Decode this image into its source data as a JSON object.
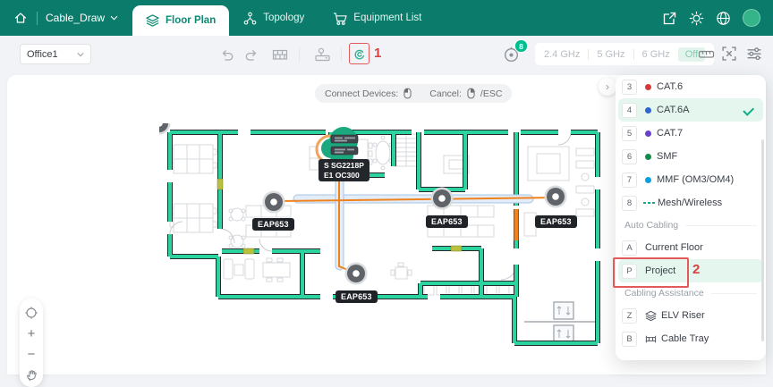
{
  "header": {
    "project_name": "Cable_Draw",
    "tabs": [
      {
        "label": "Floor Plan",
        "active": true
      },
      {
        "label": "Topology"
      },
      {
        "label": "Equipment List"
      }
    ],
    "brand_color": "#0b7c6b"
  },
  "toolbar": {
    "floor_selector_value": "Office1",
    "device_count_badge": "8",
    "wifi_bands": [
      {
        "label": "2.4 GHz"
      },
      {
        "label": "5 GHz"
      },
      {
        "label": "6 GHz"
      }
    ],
    "wifi_off_label": "Off"
  },
  "canvas_hint": {
    "connect_label": "Connect Devices:",
    "cancel_label": "Cancel:",
    "esc_label": "/ESC"
  },
  "floor_plan": {
    "switch_label_line1": "S SG2218P",
    "switch_label_line2": "E1 OC300",
    "ap_label": "EAP653",
    "wall_color": "#2bd49e",
    "cable_color": "#f0821e",
    "conduit_color": "#e3edf8"
  },
  "cable_menu": {
    "highlight_color": "#e4f6ee",
    "cables": [
      {
        "key": "3",
        "name": "CAT.6",
        "color": "#d43a3a"
      },
      {
        "key": "4",
        "name": "CAT.6A",
        "color": "#2f63cf",
        "selected": true
      },
      {
        "key": "5",
        "name": "CAT.7",
        "color": "#6a42c8"
      },
      {
        "key": "6",
        "name": "SMF",
        "color": "#128a4a"
      },
      {
        "key": "7",
        "name": "MMF (OM3/OM4)",
        "color": "#0a9fe0"
      },
      {
        "key": "8",
        "name": "Mesh/Wireless",
        "color": "#16a98c",
        "style": "dashed"
      }
    ],
    "sections": [
      {
        "title": "Auto Cabling",
        "items": [
          {
            "key": "A",
            "name": "Current Floor"
          },
          {
            "key": "P",
            "name": "Project",
            "selected": true
          }
        ]
      },
      {
        "title": "Cabling Assistance",
        "items": [
          {
            "key": "Z",
            "name": "ELV Riser"
          },
          {
            "key": "B",
            "name": "Cable Tray"
          }
        ]
      }
    ]
  },
  "annotations": {
    "step1": "1",
    "step2": "2",
    "color": "#e15b5b"
  }
}
